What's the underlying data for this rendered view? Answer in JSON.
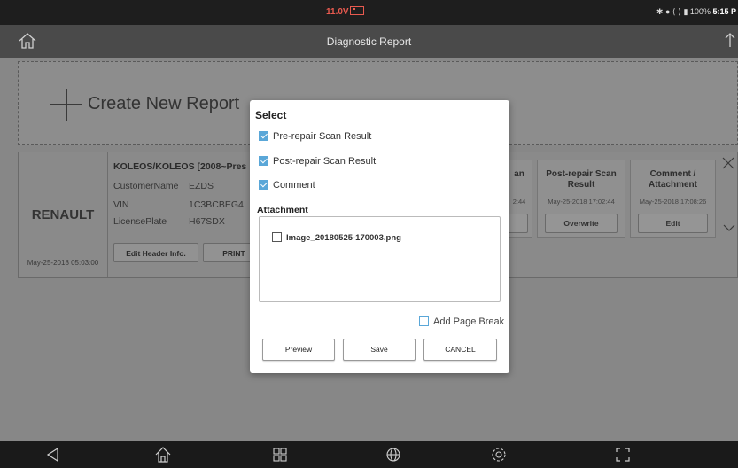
{
  "status_bar": {
    "voltage": "11.0V",
    "bluetooth": "✱",
    "signal": "⟨·⟩",
    "battery": "100%",
    "clock": "5:15 P"
  },
  "header": {
    "title": "Diagnostic Report"
  },
  "create": {
    "label": "Create New Report"
  },
  "report": {
    "brand": "RENAULT",
    "date": "May-25-2018 05:03:00",
    "model": "KOLEOS/KOLEOS [2008~Pres",
    "fields": [
      {
        "key": "CustomerName",
        "value": "EZDS"
      },
      {
        "key": "VIN",
        "value": "1C3BCBEG4"
      },
      {
        "key": "LicensePlate",
        "value": "H67SDX"
      }
    ],
    "edit_header_btn": "Edit Header Info.",
    "print_btn": "PRINT",
    "tiles": [
      {
        "title": "an",
        "date": "2:44",
        "button": ""
      },
      {
        "title": "Post-repair Scan Result",
        "date": "May-25-2018 17:02:44",
        "button": "Overwrite"
      },
      {
        "title": "Comment / Attachment",
        "date": "May-25-2018 17:08:26",
        "button": "Edit"
      }
    ]
  },
  "dialog": {
    "title": "Select",
    "options": [
      {
        "label": "Pre-repair Scan Result",
        "checked": true
      },
      {
        "label": "Post-repair Scan Result",
        "checked": true
      },
      {
        "label": "Comment",
        "checked": true
      }
    ],
    "attachment_label": "Attachment",
    "attachments": [
      {
        "label": "Image_20180525-170003.png",
        "checked": false
      }
    ],
    "page_break_label": "Add Page Break",
    "buttons": {
      "preview": "Preview",
      "save": "Save",
      "cancel": "CANCEL"
    }
  },
  "colors": {
    "accent": "#5aa7d8",
    "voltage": "#e85a4f",
    "status_bar": "#1e1e1e",
    "title_bar": "#4a4a4a"
  }
}
